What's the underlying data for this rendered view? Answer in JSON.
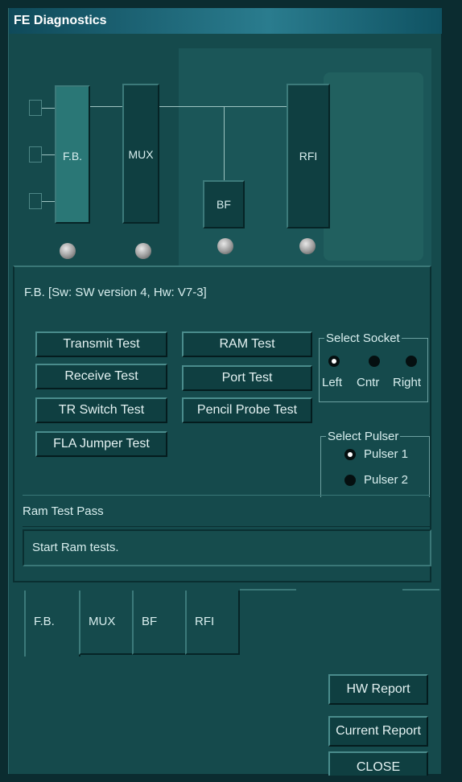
{
  "window": {
    "title": "FE Diagnostics"
  },
  "diagram": {
    "blocks": {
      "fb": "F.B.",
      "mux": "MUX",
      "bf": "BF",
      "rfi": "RFI"
    }
  },
  "panel": {
    "title": "F.B. [Sw: SW version 4, Hw: V7-3]",
    "buttons": {
      "transmit": "Transmit Test",
      "receive": "Receive Test",
      "tr_switch": "TR Switch Test",
      "fla_jumper": "FLA Jumper Test",
      "ram": "RAM Test",
      "port": "Port Test",
      "pencil_probe": "Pencil Probe Test"
    },
    "select_socket": {
      "legend": "Select Socket",
      "options": [
        "Left",
        "Cntr",
        "Right"
      ],
      "selected": "Left"
    },
    "select_pulser": {
      "legend": "Select Pulser",
      "options": [
        "Pulser 1",
        "Pulser 2"
      ],
      "selected": "Pulser 1"
    },
    "status_line": "Ram Test Pass",
    "log_line": "Start Ram tests."
  },
  "tabs": [
    "F.B.",
    "MUX",
    "BF",
    "RFI"
  ],
  "selected_tab": "F.B.",
  "actions": {
    "hw_report": "HW Report",
    "current_report": "Current Report",
    "close": "CLOSE"
  }
}
